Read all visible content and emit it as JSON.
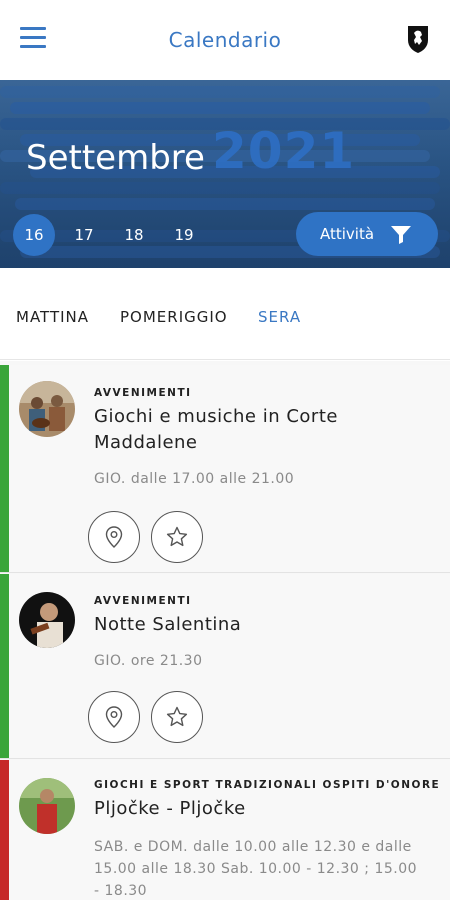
{
  "header": {
    "title": "Calendario",
    "menu_icon": "hamburger-menu-icon",
    "crest_icon": "town-crest-icon",
    "accent": "#3a78c3"
  },
  "hero": {
    "month": "Settembre",
    "year": "2021",
    "days": [
      "16",
      "17",
      "18",
      "19"
    ],
    "selected_day": "16",
    "filter_label": "Attività",
    "filter_icon": "funnel-filter-icon"
  },
  "tabs": {
    "items": [
      "MATTINA",
      "POMERIGGIO",
      "SERA"
    ],
    "active": "SERA"
  },
  "events": [
    {
      "category": "AVVENIMENTI",
      "title": "Giochi e musiche in Corte Maddalene",
      "time": "GIO. dalle 17.00 alle 21.00",
      "bar_color": "#3aa53a",
      "actions": [
        "map-pin-icon",
        "star-icon"
      ]
    },
    {
      "category": "AVVENIMENTI",
      "title": "Notte Salentina",
      "time": "GIO. ore 21.30",
      "bar_color": "#3aa53a",
      "actions": [
        "map-pin-icon",
        "star-icon"
      ]
    },
    {
      "category": "GIOCHI E SPORT TRADIZIONALI OSPITI D'ONORE",
      "title": "Pljočke - Pljočke",
      "time": "SAB. e DOM. dalle 10.00 alle 12.30 e dalle 15.00 alle 18.30 Sab. 10.00 - 12.30 ; 15.00 - 18.30",
      "bar_color": "#c62828"
    }
  ]
}
